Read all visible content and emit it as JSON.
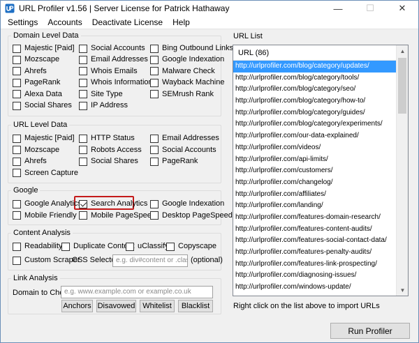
{
  "window": {
    "title": "URL Profiler v1.56 | Server License for Patrick Hathaway",
    "minimize": "—",
    "maximize": "☐",
    "close": "✕"
  },
  "menu": [
    "Settings",
    "Accounts",
    "Deactivate License",
    "Help"
  ],
  "domain_level": {
    "title": "Domain Level Data",
    "items": [
      {
        "label": "Majestic [Paid]",
        "checked": false
      },
      {
        "label": "Social Accounts",
        "checked": false
      },
      {
        "label": "Bing Outbound Links",
        "checked": false
      },
      {
        "label": "Mozscape",
        "checked": false
      },
      {
        "label": "Email Addresses",
        "checked": false
      },
      {
        "label": "Google Indexation",
        "checked": false
      },
      {
        "label": "Ahrefs",
        "checked": false
      },
      {
        "label": "Whois Emails",
        "checked": false
      },
      {
        "label": "Malware Check",
        "checked": false
      },
      {
        "label": "PageRank",
        "checked": false
      },
      {
        "label": "Whois Information",
        "checked": false
      },
      {
        "label": "Wayback Machine",
        "checked": false
      },
      {
        "label": "Alexa Data",
        "checked": false
      },
      {
        "label": "Site Type",
        "checked": false
      },
      {
        "label": "SEMrush Rank",
        "checked": false
      },
      {
        "label": "Social Shares",
        "checked": false
      },
      {
        "label": "IP Address",
        "checked": false
      }
    ]
  },
  "url_level": {
    "title": "URL Level Data",
    "items": [
      {
        "label": "Majestic [Paid]",
        "checked": false
      },
      {
        "label": "HTTP Status",
        "checked": false
      },
      {
        "label": "Email Addresses",
        "checked": false
      },
      {
        "label": "Mozscape",
        "checked": false
      },
      {
        "label": "Robots Access",
        "checked": false
      },
      {
        "label": "Social Accounts",
        "checked": false
      },
      {
        "label": "Ahrefs",
        "checked": false
      },
      {
        "label": "Social Shares",
        "checked": false
      },
      {
        "label": "PageRank",
        "checked": false
      },
      {
        "label": "Screen Capture",
        "checked": false
      }
    ]
  },
  "google": {
    "title": "Google",
    "items": [
      {
        "label": "Google Analytics",
        "checked": false
      },
      {
        "label": "Search Analytics",
        "checked": true
      },
      {
        "label": "Google Indexation",
        "checked": false
      },
      {
        "label": "Mobile Friendly",
        "checked": false
      },
      {
        "label": "Mobile PageSpeed",
        "checked": false
      },
      {
        "label": "Desktop PageSpeed",
        "checked": false
      }
    ]
  },
  "content": {
    "title": "Content Analysis",
    "readability": "Readability",
    "duplicate": "Duplicate Content",
    "uclassify": "uClassify",
    "copyscape": "Copyscape",
    "custom_scraper": "Custom Scraper",
    "css_selector_label": "CSS Selector:",
    "css_selector_placeholder": "e.g. div#content or .class-na",
    "optional": "(optional)"
  },
  "link": {
    "title": "Link Analysis",
    "domain_label": "Domain to Check:",
    "domain_placeholder": "e.g. www.example.com or example.co.uk",
    "buttons": [
      "Anchors",
      "Disavowed",
      "Whitelist",
      "Blacklist"
    ]
  },
  "url_list": {
    "title": "URL List",
    "header": "URL (86)",
    "urls": [
      "http://urlprofiler.com/blog/category/updates/",
      "http://urlprofiler.com/blog/category/tools/",
      "http://urlprofiler.com/blog/category/seo/",
      "http://urlprofiler.com/blog/category/how-to/",
      "http://urlprofiler.com/blog/category/guides/",
      "http://urlprofiler.com/blog/category/experiments/",
      "http://urlprofiler.com/our-data-explained/",
      "http://urlprofiler.com/videos/",
      "http://urlprofiler.com/api-limits/",
      "http://urlprofiler.com/customers/",
      "http://urlprofiler.com/changelog/",
      "http://urlprofiler.com/affiliates/",
      "http://urlprofiler.com/landing/",
      "http://urlprofiler.com/features-domain-research/",
      "http://urlprofiler.com/features-content-audits/",
      "http://urlprofiler.com/features-social-contact-data/",
      "http://urlprofiler.com/features-penalty-audits/",
      "http://urlprofiler.com/features-link-prospecting/",
      "http://urlprofiler.com/diagnosing-issues/",
      "http://urlprofiler.com/windows-update/"
    ],
    "hint": "Right click on the list above to import URLs"
  },
  "run_button": "Run Profiler",
  "colors": {
    "highlight": "#c41a1a",
    "selection": "#3399ff"
  }
}
